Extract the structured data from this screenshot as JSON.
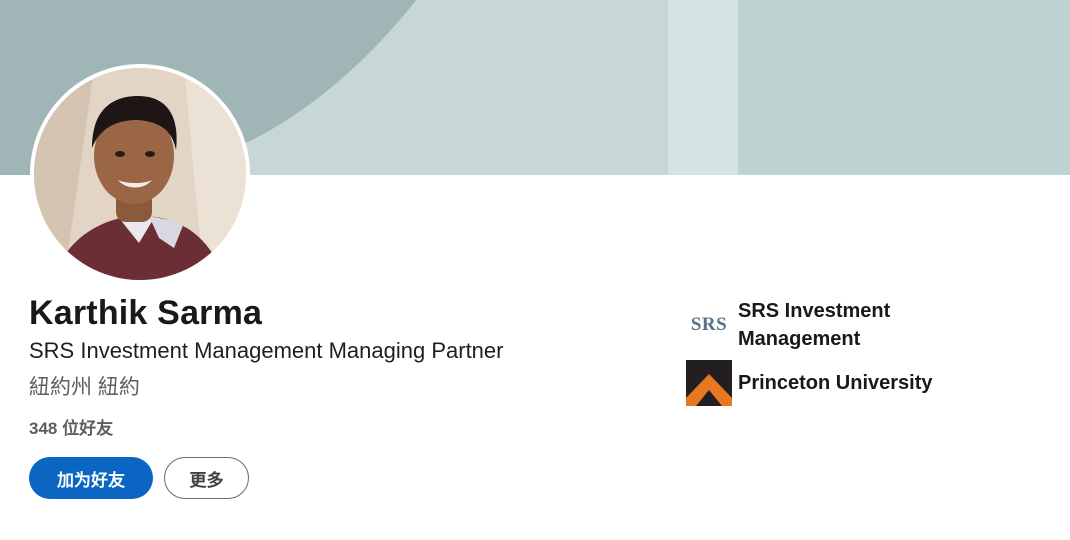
{
  "profile": {
    "name": "Karthik Sarma",
    "headline": "SRS Investment Management Managing Partner",
    "location": "紐約州 紐約",
    "connections": "348 位好友"
  },
  "actions": {
    "connect_label": "加为好友",
    "more_label": "更多"
  },
  "organizations": [
    {
      "name": "SRS Investment Management",
      "logo_text": "SRS",
      "icon": "srs-logo-icon"
    },
    {
      "name": "Princeton University",
      "icon": "princeton-logo-icon"
    }
  ],
  "colors": {
    "primary_button": "#0a66c2",
    "banner": "#a0b5b6",
    "princeton_orange": "#e87722"
  }
}
